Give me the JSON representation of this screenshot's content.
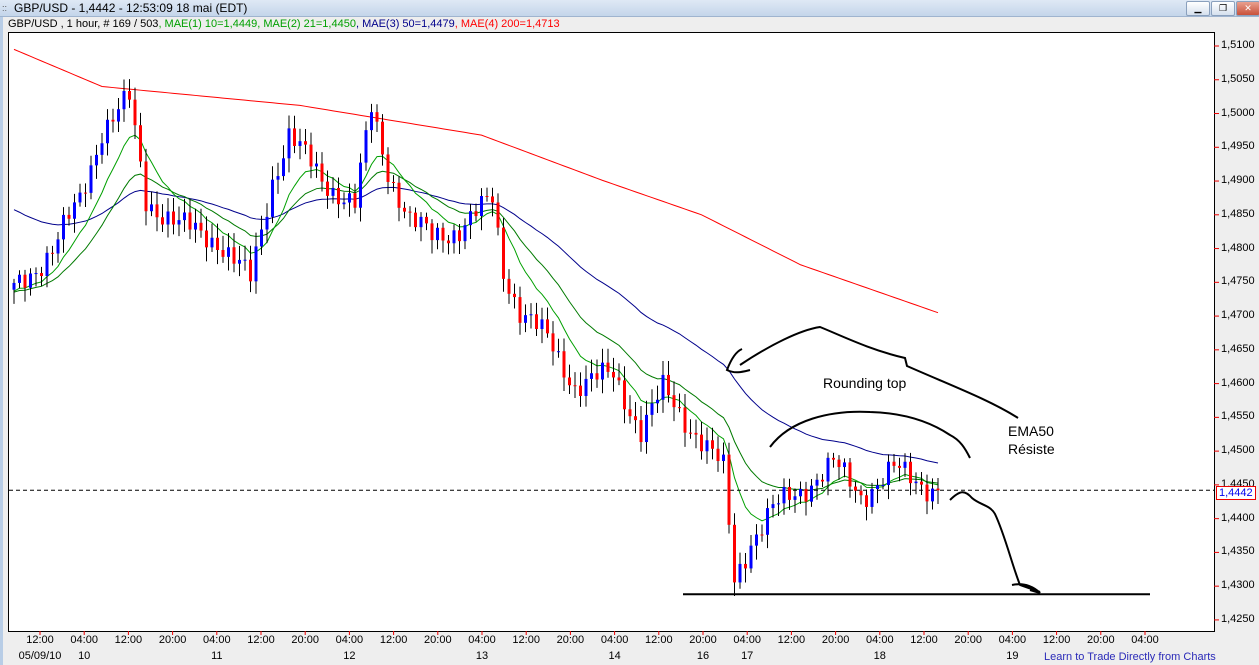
{
  "window": {
    "title": "GBP/USD - 1,4442 - 12:53:09  18 mai (EDT)",
    "buttons": [
      "minimize",
      "restore",
      "close"
    ]
  },
  "info": {
    "symbol": "GBP/USD , 1 hour, # 169 / 503",
    "ma1": ", MAE(1) 10=1,4449",
    "ma2": ", MAE(2) 21=1,4450",
    "ma3": ", MAE(3) 50=1,4479",
    "ma4": ", MAE(4) 200=1,4713"
  },
  "colors": {
    "up": "#0000ff",
    "down": "#ff0000",
    "ma10": "#00a000",
    "ma21": "#007a00",
    "ma50": "#00008b",
    "ma200": "#ff0000",
    "last": "#0000ee"
  },
  "footer_link": "Learn to Trade Directly from Charts",
  "last_price": "1,4442",
  "annotations": {
    "rounding": "Rounding top",
    "ema": "EMA50",
    "resiste": "Résiste"
  },
  "chart_data": {
    "type": "candlestick",
    "title": "GBP/USD , 1 hour",
    "ylim": [
      1.4235,
      1.5155
    ],
    "y_ticks": [
      "1,5100",
      "1,5050",
      "1,5000",
      "1,4950",
      "1,4900",
      "1,4850",
      "1,4800",
      "1,4750",
      "1,4700",
      "1,4650",
      "1,4600",
      "1,4550",
      "1,4500",
      "1,4450",
      "1,4400",
      "1,4350",
      "1,4300",
      "1,4250"
    ],
    "y_tick_values": [
      1.51,
      1.505,
      1.5,
      1.495,
      1.49,
      1.485,
      1.48,
      1.475,
      1.47,
      1.465,
      1.46,
      1.455,
      1.45,
      1.445,
      1.44,
      1.435,
      1.43,
      1.425
    ],
    "x_time_labels": [
      "12:00",
      "04:00",
      "12:00",
      "20:00",
      "04:00",
      "12:00",
      "20:00",
      "04:00",
      "12:00",
      "20:00",
      "04:00",
      "12:00",
      "20:00",
      "04:00",
      "12:00",
      "20:00",
      "04:00",
      "12:00",
      "20:00",
      "04:00",
      "12:00",
      "20:00",
      "04:00",
      "12:00",
      "20:00",
      "04:00"
    ],
    "x_date_labels": [
      {
        "tick": 0,
        "text": "05/09/10"
      },
      {
        "tick": 1,
        "text": "10"
      },
      {
        "tick": 4,
        "text": "11"
      },
      {
        "tick": 7,
        "text": "12"
      },
      {
        "tick": 10,
        "text": "13"
      },
      {
        "tick": 13,
        "text": "14"
      },
      {
        "tick": 15,
        "text": "16"
      },
      {
        "tick": 16,
        "text": "17"
      },
      {
        "tick": 19,
        "text": "18"
      },
      {
        "tick": 22,
        "text": "19"
      }
    ],
    "bars": 169,
    "close_keypoints": [
      [
        0,
        1.4739
      ],
      [
        7,
        1.4798
      ],
      [
        12,
        1.4872
      ],
      [
        16,
        1.4976
      ],
      [
        21,
        1.502
      ],
      [
        24,
        1.4872
      ],
      [
        30,
        1.4835
      ],
      [
        37,
        1.4813
      ],
      [
        43,
        1.4753
      ],
      [
        47,
        1.4902
      ],
      [
        50,
        1.4968
      ],
      [
        56,
        1.4902
      ],
      [
        62,
        1.4865
      ],
      [
        65,
        1.5005
      ],
      [
        68,
        1.4916
      ],
      [
        72,
        1.4842
      ],
      [
        76,
        1.4816
      ],
      [
        81,
        1.483
      ],
      [
        87,
        1.4872
      ],
      [
        89,
        1.4768
      ],
      [
        92,
        1.4709
      ],
      [
        97,
        1.4665
      ],
      [
        102,
        1.4598
      ],
      [
        109,
        1.4613
      ],
      [
        114,
        1.4531
      ],
      [
        118,
        1.459
      ],
      [
        125,
        1.4516
      ],
      [
        129,
        1.4472
      ],
      [
        131,
        1.4309
      ],
      [
        134,
        1.4368
      ],
      [
        138,
        1.4413
      ],
      [
        143,
        1.4442
      ],
      [
        149,
        1.448
      ],
      [
        154,
        1.4435
      ],
      [
        160,
        1.4472
      ],
      [
        168,
        1.4442
      ]
    ],
    "ma200_keypoints": [
      [
        0,
        1.5095
      ],
      [
        16,
        1.504
      ],
      [
        52,
        1.5012
      ],
      [
        85,
        1.4968
      ],
      [
        107,
        1.4901
      ],
      [
        125,
        1.485
      ],
      [
        143,
        1.4776
      ],
      [
        168,
        1.4705
      ]
    ],
    "ma50_start": 1.4862,
    "last_price": 1.4442,
    "support_level": 1.4288
  }
}
